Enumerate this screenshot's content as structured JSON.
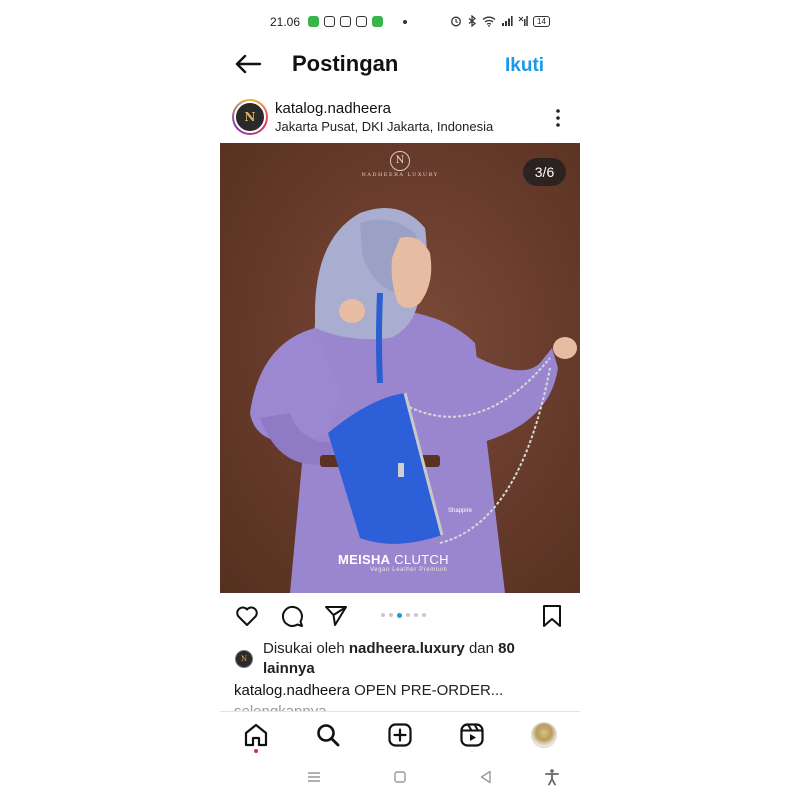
{
  "status_bar": {
    "time": "21.06",
    "battery": "14"
  },
  "header": {
    "title": "Postingan",
    "follow_label": "Ikuti"
  },
  "post": {
    "username": "katalog.nadheera",
    "location": "Jakarta Pusat, DKI Jakarta, Indonesia",
    "image_counter": "3/6",
    "current_image": 3,
    "total_images": 6,
    "brand_logo_letter": "N",
    "brand_name": "NADHEERA LUXURY",
    "product_title_bold": "MEISHA",
    "product_title_rest": " CLUTCH",
    "product_subtitle": "Vegan Leather Premium",
    "bag_label": "Shappire"
  },
  "likes": {
    "prefix": "Disukai oleh ",
    "user": "nadheera.luxury",
    "middle": " dan ",
    "count": "80",
    "suffix": "lainnya"
  },
  "caption": {
    "username": "katalog.nadheera",
    "text": " OPEN PRE-ORDER...",
    "more": "selengkapnya"
  },
  "colors": {
    "accent": "#1a9ae6",
    "notification_dot": "#e0245e",
    "photo_background": "#663a2b"
  },
  "icons": {
    "back": "arrow-left-icon",
    "more": "more-vertical-icon",
    "like": "heart-icon",
    "comment": "comment-icon",
    "share": "send-icon",
    "save": "bookmark-icon",
    "home": "home-icon",
    "search": "search-icon",
    "create": "plus-square-icon",
    "reels": "reels-icon"
  }
}
